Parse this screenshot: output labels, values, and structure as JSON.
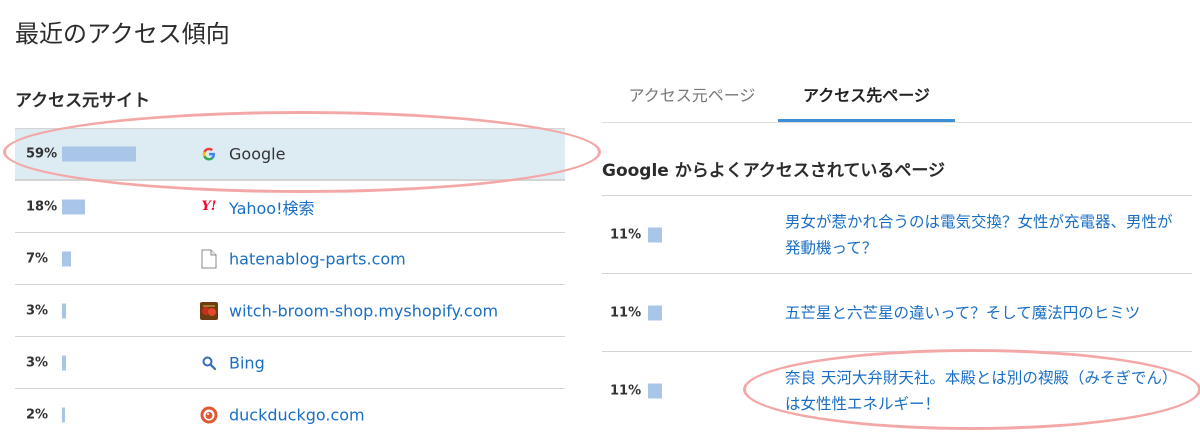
{
  "page_title": "最近のアクセス傾向",
  "sources": {
    "title": "アクセス元サイト",
    "items": [
      {
        "percent": "59%",
        "value": 59,
        "name": "Google",
        "icon": "google-icon"
      },
      {
        "percent": "18%",
        "value": 18,
        "name": "Yahoo!検索",
        "icon": "yahoo-icon"
      },
      {
        "percent": "7%",
        "value": 7,
        "name": "hatenablog-parts.com",
        "icon": "document-icon"
      },
      {
        "percent": "3%",
        "value": 3,
        "name": "witch-broom-shop.myshopify.com",
        "icon": "shop-favicon-icon"
      },
      {
        "percent": "3%",
        "value": 3,
        "name": "Bing",
        "icon": "search-icon"
      },
      {
        "percent": "2%",
        "value": 2,
        "name": "duckduckgo.com",
        "icon": "duckduckgo-icon"
      }
    ]
  },
  "tabs": [
    {
      "label": "アクセス元ページ",
      "active": false
    },
    {
      "label": "アクセス先ページ",
      "active": true
    }
  ],
  "pages": {
    "heading": "Google からよくアクセスされているページ",
    "items": [
      {
        "percent": "11%",
        "value": 11,
        "title": "男女が惹かれ合うのは電気交換？女性が充電器、男性が発動機って？"
      },
      {
        "percent": "11%",
        "value": 11,
        "title": "五芒星と六芒星の違いって？そして魔法円のヒミツ"
      },
      {
        "percent": "11%",
        "value": 11,
        "title": "奈良 天河大弁財天社。本殿とは別の禊殿（みそぎでん）は女性性エネルギー！"
      }
    ]
  },
  "colors": {
    "bar": "#a9c6e8",
    "link": "#1a6fc4",
    "active_row": "#ddebf3",
    "tab_accent": "#3c8fd4",
    "annotation": "#f4a7a7"
  }
}
